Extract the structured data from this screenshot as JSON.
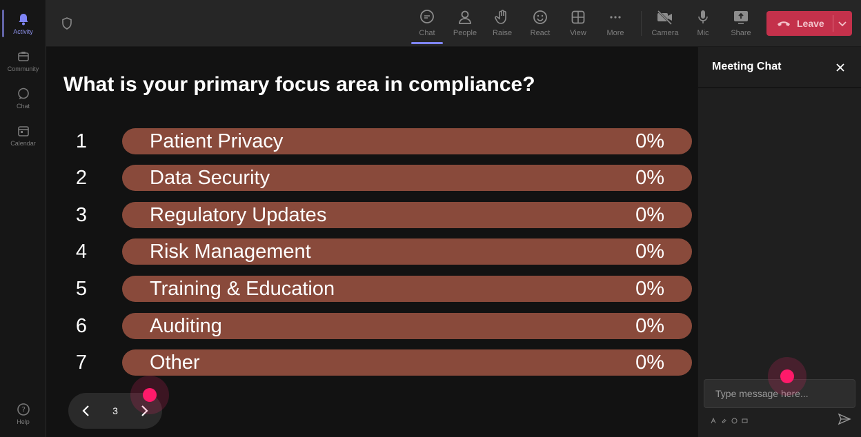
{
  "rail": {
    "items": [
      {
        "name": "activity",
        "label": "Activity",
        "active": true
      },
      {
        "name": "community",
        "label": "Community"
      },
      {
        "name": "chat",
        "label": "Chat"
      },
      {
        "name": "calendar",
        "label": "Calendar"
      }
    ],
    "help_label": "Help"
  },
  "toolbar": {
    "buttons": [
      {
        "name": "chat",
        "label": "Chat",
        "icon": "chat-bubble-icon",
        "active": true
      },
      {
        "name": "people",
        "label": "People",
        "icon": "person-icon"
      },
      {
        "name": "raise",
        "label": "Raise",
        "icon": "raise-hand-icon"
      },
      {
        "name": "react",
        "label": "React",
        "icon": "smiley-icon"
      },
      {
        "name": "view",
        "label": "View",
        "icon": "grid-icon"
      },
      {
        "name": "more",
        "label": "More",
        "icon": "ellipsis-icon"
      },
      {
        "name": "camera",
        "label": "Camera",
        "icon": "camera-off-icon"
      },
      {
        "name": "mic",
        "label": "Mic",
        "icon": "mic-icon"
      },
      {
        "name": "share",
        "label": "Share",
        "icon": "share-screen-icon"
      }
    ],
    "leave_label": "Leave"
  },
  "poll": {
    "question": "What is your primary focus area in compliance?",
    "options": [
      {
        "number": "1",
        "label": "Patient Privacy",
        "percent": "0%",
        "fraction": 0
      },
      {
        "number": "2",
        "label": "Data Security",
        "percent": "0%",
        "fraction": 0
      },
      {
        "number": "3",
        "label": "Regulatory Updates",
        "percent": "0%",
        "fraction": 0
      },
      {
        "number": "4",
        "label": "Risk Management",
        "percent": "0%",
        "fraction": 0
      },
      {
        "number": "5",
        "label": "Training & Education",
        "percent": "0%",
        "fraction": 0
      },
      {
        "number": "6",
        "label": "Auditing",
        "percent": "0%",
        "fraction": 0
      },
      {
        "number": "7",
        "label": "Other",
        "percent": "0%",
        "fraction": 0
      }
    ],
    "bar_color": "#894a3b"
  },
  "pager": {
    "current_page": "3"
  },
  "chat": {
    "title": "Meeting Chat",
    "input_placeholder": "Type message here..."
  },
  "colors": {
    "accent": "#7f85f5",
    "leave": "#c4314b",
    "click_marker": "#ff1a6a"
  }
}
